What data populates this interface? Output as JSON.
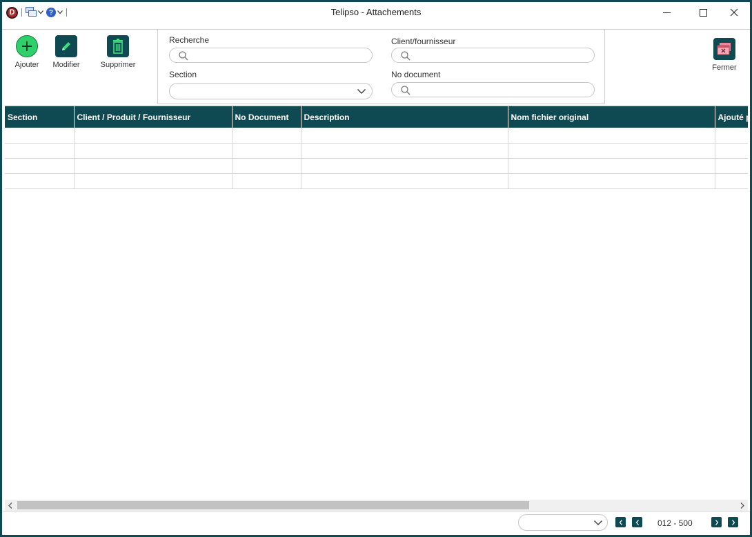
{
  "window": {
    "title": "Telipso - Attachements",
    "app_logo": "D",
    "help_glyph": "?"
  },
  "toolbar": {
    "add_label": "Ajouter",
    "edit_label": "Modifier",
    "delete_label": "Supprimer",
    "close_label": "Fermer"
  },
  "filters": {
    "search_label": "Recherche",
    "search_value": "",
    "section_label": "Section",
    "section_value": "",
    "client_label": "Client/fournisseur",
    "client_value": "",
    "doc_label": "No document",
    "doc_value": ""
  },
  "table": {
    "columns": [
      "Section",
      "Client / Produit / Fournisseur",
      "No Document",
      "Description",
      "Nom fichier original",
      "Ajouté par"
    ],
    "rows": [
      [
        "",
        "",
        "",
        "",
        "",
        ""
      ],
      [
        "",
        "",
        "",
        "",
        "",
        ""
      ],
      [
        "",
        "",
        "",
        "",
        "",
        ""
      ],
      [
        "",
        "",
        "",
        "",
        "",
        ""
      ]
    ]
  },
  "footer": {
    "page_select_value": "",
    "page_info": "012 - 500"
  },
  "colors": {
    "accent": "#0f4a52",
    "add_green": "#2fd06c"
  }
}
